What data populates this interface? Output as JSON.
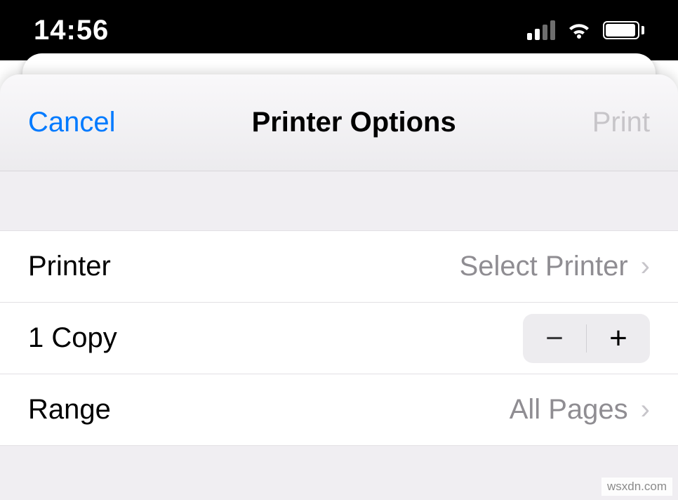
{
  "statusbar": {
    "time": "14:56",
    "battery_pct": 95
  },
  "navbar": {
    "cancel": "Cancel",
    "title": "Printer Options",
    "print": "Print"
  },
  "rows": {
    "printer_label": "Printer",
    "printer_value": "Select Printer",
    "copies_label": "1 Copy",
    "range_label": "Range",
    "range_value": "All Pages"
  },
  "watermark": "wsxdn.com"
}
